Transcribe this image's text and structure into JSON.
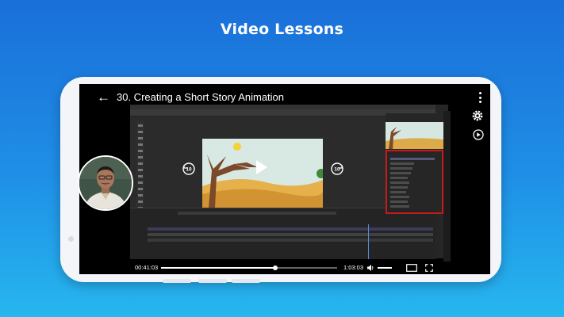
{
  "page": {
    "headline": "Video Lessons"
  },
  "player": {
    "back_icon": "arrow-left-icon",
    "title": "30. Creating a Short Story Animation",
    "menu_icon": "more-vertical-icon",
    "settings_icon": "gear-icon",
    "speed_icon": "play-circle-icon",
    "rewind_seconds": "10",
    "forward_seconds": "10",
    "play_icon": "play-icon",
    "current_time": "00:41:03",
    "duration": "1:03:03",
    "progress_fraction": 0.65,
    "volume_icon": "speaker-icon",
    "volume_fraction": 1.0,
    "captions_icon": "captions-icon",
    "fullscreen_icon": "fullscreen-icon"
  },
  "instructor": {
    "avatar": "instructor-photo"
  },
  "colors": {
    "background_top": "#1a6fd9",
    "background_bottom": "#27b6ef",
    "highlight_box": "#c81a1a"
  }
}
